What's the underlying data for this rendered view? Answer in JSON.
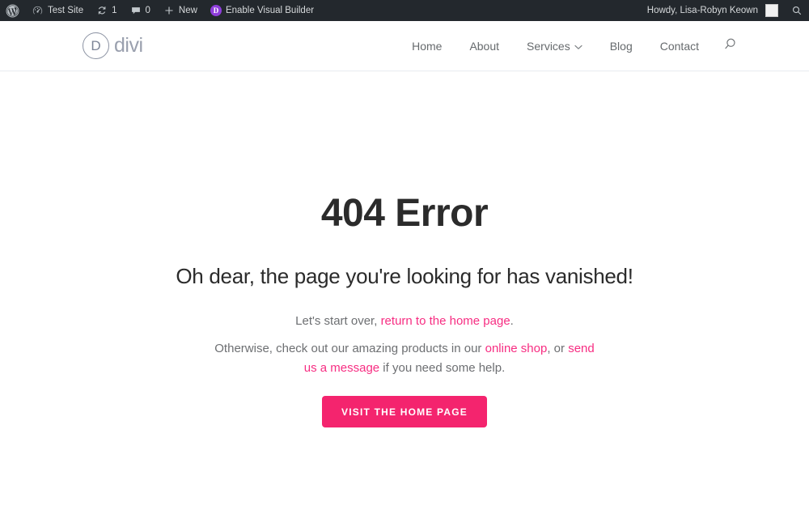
{
  "admin_bar": {
    "left_items": [
      {
        "name": "wp-logo",
        "icon": "wordpress-icon",
        "label": ""
      },
      {
        "name": "site-name",
        "icon": "dashboard-icon",
        "label": "Test Site"
      },
      {
        "name": "updates",
        "icon": "updates-icon",
        "label": "1"
      },
      {
        "name": "comments",
        "icon": "comment-bubble-icon",
        "label": "0"
      },
      {
        "name": "new-content",
        "icon": "plus-icon",
        "label": "New"
      },
      {
        "name": "enable-visual-builder",
        "icon": "divi-d-icon",
        "label": "Enable Visual Builder"
      }
    ],
    "site_name": "Test Site",
    "updates_count": "1",
    "comments_count": "0",
    "new_label": "New",
    "visual_builder_label": "Enable Visual Builder",
    "divi_badge_letter": "D",
    "howdy": "Howdy, Lisa-Robyn Keown",
    "search_icon": "search-icon",
    "background": "#23282d",
    "text_color": "#d6d9db",
    "divi_accent": "#8f3edb"
  },
  "header": {
    "logo": {
      "mark": "D",
      "word": "divi"
    },
    "nav": [
      {
        "label": "Home",
        "has_dropdown": false
      },
      {
        "label": "About",
        "has_dropdown": false
      },
      {
        "label": "Services",
        "has_dropdown": true
      },
      {
        "label": "Blog",
        "has_dropdown": false
      },
      {
        "label": "Contact",
        "has_dropdown": false
      }
    ],
    "search_icon": "search-icon"
  },
  "content": {
    "title": "404 Error",
    "subtitle": "Oh dear, the page you're looking for has vanished!",
    "paragraph_1": {
      "before": "Let's start over, ",
      "link": "return to the home page",
      "after": "."
    },
    "paragraph_2": {
      "before": "Otherwise, check out our amazing products in our ",
      "link1": "online shop",
      "middle": ", or ",
      "link2": "send us a message",
      "after": " if you need some help."
    },
    "button_label": "VISIT THE HOME PAGE",
    "accent_color": "#f4246e",
    "link_color": "#f72d82",
    "title_color": "#2b2b2b"
  }
}
